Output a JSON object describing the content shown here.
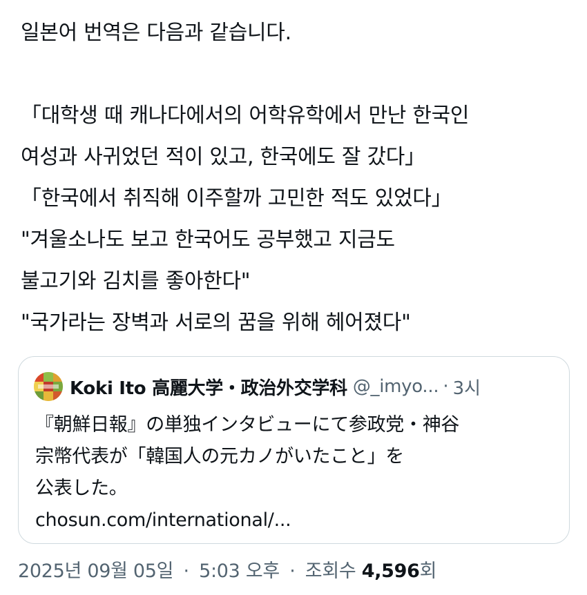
{
  "tweet": {
    "lines": [
      "일본어 번역은 다음과 같습니다.",
      "",
      "「대학생 때 캐나다에서의 어학유학에서 만난 한국인",
      "여성과 사귀었던 적이 있고, 한국에도 잘 갔다」",
      "「한국에서 취직해 이주할까 고민한 적도 있었다」",
      "\"겨울소나도 보고 한국어도 공부했고 지금도",
      "불고기와 김치를 좋아한다\"",
      "\"국가라는 장벽과 서로의 꿈을 위해 헤어졌다\""
    ]
  },
  "quote": {
    "author_name": "Koki Ito 高麗大学・政治外交学科",
    "handle": "@_imyo...",
    "separator": "·",
    "time": "3시",
    "lines": [
      "『朝鮮日報』の単独インタビューにて参政党・神谷",
      "宗幣代表が「韓国人の元カノがいたこと」を",
      "公表した。",
      "chosun.com/international/..."
    ]
  },
  "meta": {
    "date": "2025년 09월 05일",
    "time": "5:03 오후",
    "views_label": "조회수",
    "views_count": "4,596",
    "views_suffix": "회",
    "separator": "·"
  },
  "colors": {
    "text": "#0f1419",
    "secondary": "#536471",
    "border": "#cfd9de"
  }
}
